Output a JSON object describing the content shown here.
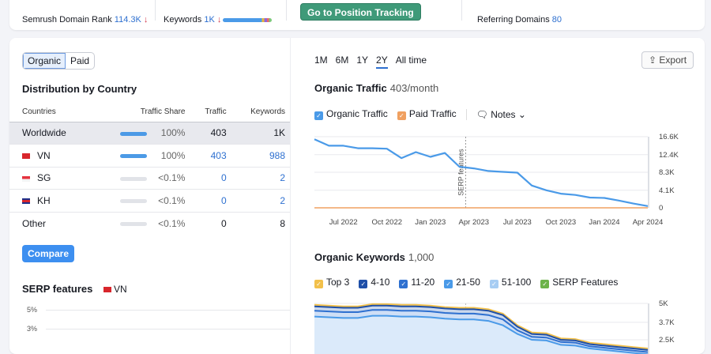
{
  "top": {
    "domain_rank_label": "Semrush Domain Rank",
    "domain_rank_value": "114.3K",
    "keywords_label": "Keywords",
    "keywords_value": "1K",
    "down_arrow": "↓",
    "position_tracking_button": "Go to Position Tracking",
    "referring_label": "Referring Domains",
    "referring_value": "80"
  },
  "left": {
    "toggle": [
      "Organic",
      "Paid"
    ],
    "title": "Distribution by Country",
    "columns": [
      "Countries",
      "Traffic Share",
      "Traffic",
      "Keywords"
    ],
    "rows": [
      {
        "country": "Worldwide",
        "share": "100%",
        "share_pct": 100,
        "traffic": "403",
        "keywords": "1K"
      },
      {
        "country": "VN",
        "flag": "vn",
        "share": "100%",
        "share_pct": 100,
        "traffic": "403",
        "keywords": "988"
      },
      {
        "country": "SG",
        "flag": "sg",
        "share": "<0.1%",
        "share_pct": 0.1,
        "traffic": "0",
        "keywords": "2"
      },
      {
        "country": "KH",
        "flag": "kh",
        "share": "<0.1%",
        "share_pct": 0.1,
        "traffic": "0",
        "keywords": "2"
      },
      {
        "country": "Other",
        "share": "<0.1%",
        "share_pct": 0.1,
        "traffic": "0",
        "keywords": "8"
      }
    ],
    "compare_button": "Compare",
    "serp_title": "SERP features",
    "serp_country": "VN",
    "serp_ticks": [
      "5%",
      "3%"
    ]
  },
  "right": {
    "periods": [
      "1M",
      "6M",
      "1Y",
      "2Y",
      "All time"
    ],
    "active_period": "2Y",
    "export_button": "Export",
    "traffic_title": "Organic Traffic",
    "traffic_sub": "403/month",
    "traffic_legend": [
      "Organic Traffic",
      "Paid Traffic"
    ],
    "notes": "Notes",
    "keywords_title": "Organic Keywords",
    "keywords_sub": "1,000",
    "keywords_legend": [
      "Top 3",
      "4-10",
      "11-20",
      "21-50",
      "51-100",
      "SERP Features"
    ]
  },
  "colors": {
    "organic": "#4a9ae8",
    "paid": "#f0a060",
    "top3": "#f2c04a",
    "p4_10": "#1e4fa8",
    "p11_20": "#2e70d0",
    "p21_50": "#4a9ae8",
    "p51_100": "#a7cdf3",
    "serp": "#6db34a",
    "accent": "#2e70d0"
  },
  "chart_data": [
    {
      "type": "line",
      "title": "Organic Traffic",
      "yticks": [
        "16.6K",
        "12.4K",
        "8.3K",
        "4.1K",
        "0"
      ],
      "ylim": [
        0,
        16600
      ],
      "xticks": [
        "Jul 2022",
        "Oct 2022",
        "Jan 2023",
        "Apr 2023",
        "Jul 2023",
        "Oct 2023",
        "Jan 2024",
        "Apr 2024"
      ],
      "annotation": {
        "label": "SERP features",
        "date": "2023-03"
      },
      "x": [
        "2022-05",
        "2022-06",
        "2022-07",
        "2022-08",
        "2022-09",
        "2022-10",
        "2022-11",
        "2022-12",
        "2023-01",
        "2023-02",
        "2023-03",
        "2023-04",
        "2023-05",
        "2023-06",
        "2023-07",
        "2023-08",
        "2023-09",
        "2023-10",
        "2023-11",
        "2023-12",
        "2024-01",
        "2024-02",
        "2024-03",
        "2024-04"
      ],
      "series": [
        {
          "name": "Organic Traffic",
          "values": [
            16000,
            14500,
            14500,
            13900,
            13900,
            13800,
            11600,
            13000,
            11900,
            12800,
            9600,
            9200,
            8600,
            8400,
            8200,
            5200,
            4100,
            3300,
            3000,
            2400,
            2300,
            1700,
            1000,
            400
          ]
        },
        {
          "name": "Paid Traffic",
          "values": [
            0,
            0,
            0,
            0,
            0,
            0,
            0,
            0,
            0,
            0,
            0,
            0,
            0,
            0,
            0,
            0,
            0,
            0,
            0,
            0,
            0,
            0,
            0,
            0
          ]
        }
      ]
    },
    {
      "type": "area",
      "title": "Organic Keywords",
      "yticks": [
        "5K",
        "3.7K",
        "2.5K"
      ],
      "ylim": [
        0,
        5000
      ],
      "x": [
        "2022-05",
        "2022-06",
        "2022-07",
        "2022-08",
        "2022-09",
        "2022-10",
        "2022-11",
        "2022-12",
        "2023-01",
        "2023-02",
        "2023-03",
        "2023-04",
        "2023-05",
        "2023-06",
        "2023-07",
        "2023-08",
        "2023-09",
        "2023-10",
        "2023-11",
        "2023-12",
        "2024-01",
        "2024-02",
        "2024-03",
        "2024-04"
      ],
      "series": [
        {
          "name": "Top 3",
          "values": [
            4900,
            4850,
            4800,
            4800,
            4950,
            4950,
            4900,
            4900,
            4850,
            4750,
            4700,
            4700,
            4600,
            4300,
            3500,
            3000,
            2950,
            2600,
            2550,
            2300,
            2200,
            2100,
            2000,
            1900
          ]
        },
        {
          "name": "4-10",
          "values": [
            4800,
            4750,
            4700,
            4700,
            4850,
            4850,
            4800,
            4800,
            4750,
            4650,
            4600,
            4600,
            4500,
            4200,
            3400,
            2900,
            2850,
            2500,
            2450,
            2200,
            2100,
            2000,
            1900,
            1800
          ]
        },
        {
          "name": "11-20",
          "values": [
            4500,
            4450,
            4400,
            4400,
            4550,
            4550,
            4500,
            4500,
            4450,
            4350,
            4300,
            4300,
            4200,
            3900,
            3150,
            2700,
            2650,
            2350,
            2300,
            2050,
            1950,
            1850,
            1750,
            1650
          ]
        },
        {
          "name": "21-50",
          "values": [
            4100,
            4050,
            4000,
            4000,
            4150,
            4150,
            4100,
            4100,
            4050,
            3950,
            3900,
            3900,
            3800,
            3500,
            2900,
            2500,
            2450,
            2150,
            2100,
            1900,
            1800,
            1700,
            1600,
            1500
          ]
        }
      ]
    }
  ]
}
